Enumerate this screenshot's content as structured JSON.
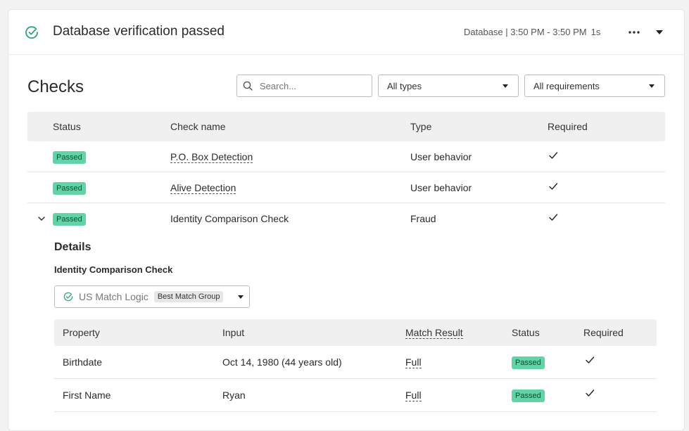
{
  "header": {
    "title": "Database verification passed",
    "meta": "Database | 3:50 PM - 3:50 PM",
    "duration": "1s"
  },
  "checks": {
    "title": "Checks",
    "search_placeholder": "Search...",
    "type_filter": "All types",
    "requirement_filter": "All requirements",
    "columns": [
      "Status",
      "Check name",
      "Type",
      "Required"
    ],
    "rows": [
      {
        "status": "Passed",
        "name": "P.O. Box Detection",
        "type": "User behavior",
        "required": true
      },
      {
        "status": "Passed",
        "name": "Alive Detection",
        "type": "User behavior",
        "required": true
      },
      {
        "status": "Passed",
        "name": "Identity Comparison Check",
        "type": "Fraud",
        "required": true
      }
    ]
  },
  "details": {
    "title": "Details",
    "subtitle": "Identity Comparison Check",
    "logic_label": "US Match Logic",
    "logic_tag": "Best Match Group",
    "columns": [
      "Property",
      "Input",
      "Match Result",
      "Status",
      "Required"
    ],
    "rows": [
      {
        "property": "Birthdate",
        "input": "Oct 14, 1980 (44 years old)",
        "match": "Full",
        "status": "Passed",
        "required": true
      },
      {
        "property": "First Name",
        "input": "Ryan",
        "match": "Full",
        "status": "Passed",
        "required": true
      }
    ]
  },
  "colors": {
    "accent_green": "#2fa37a",
    "badge_bg": "#5fd4a6",
    "badge_text": "#0f4a33"
  },
  "icons": {
    "header_status": "circle-check-icon",
    "more": "more-dots-icon",
    "collapse": "caret-down-icon",
    "search": "search-icon",
    "required": "check-icon"
  }
}
